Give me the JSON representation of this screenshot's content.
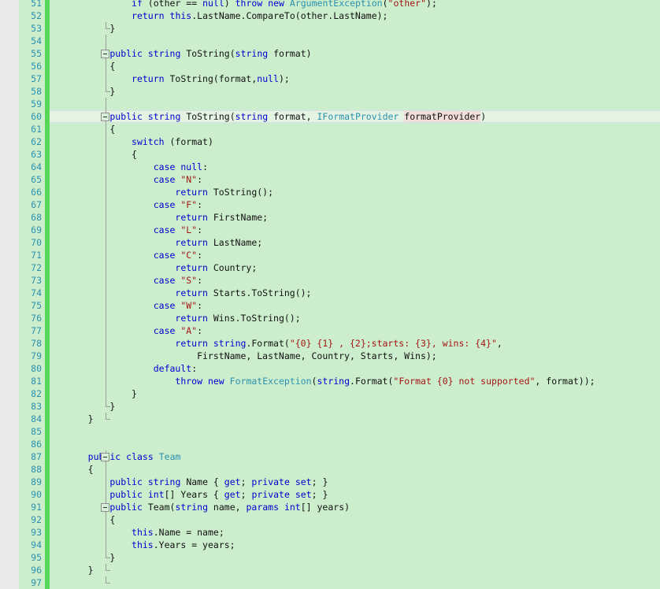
{
  "editor": {
    "language": "csharp",
    "first_visible_line": 51,
    "last_visible_line": 97,
    "current_line": 60,
    "line_height_px": 16,
    "colors": {
      "background": "#cdeecd",
      "current_line_background": "#e3f4e3",
      "gutter_background": "#cdeecd",
      "left_strip": "#e9e9ec",
      "change_bar": "#57d957",
      "line_number": "#2b91af",
      "keyword": "#0000d0",
      "type": "#2b91af",
      "string": "#a31515",
      "plain_text": "#101010",
      "fold_marker": "#8e8e8e",
      "highlighted_identifier": "#f1ded8"
    }
  },
  "lines": [
    {
      "number": 51,
      "indent": 12,
      "fold": null,
      "tokens": [
        {
          "t": "if",
          "c": "kw"
        },
        {
          "t": " (other == ",
          "c": "pln"
        },
        {
          "t": "null",
          "c": "kw"
        },
        {
          "t": ") ",
          "c": "pln"
        },
        {
          "t": "throw",
          "c": "kw"
        },
        {
          "t": " ",
          "c": "pln"
        },
        {
          "t": "new",
          "c": "kw"
        },
        {
          "t": " ",
          "c": "pln"
        },
        {
          "t": "ArgumentException",
          "c": "typ"
        },
        {
          "t": "(",
          "c": "pln"
        },
        {
          "t": "\"other\"",
          "c": "str"
        },
        {
          "t": ");",
          "c": "pln"
        }
      ]
    },
    {
      "number": 52,
      "indent": 12,
      "fold": null,
      "tokens": [
        {
          "t": "return",
          "c": "kw"
        },
        {
          "t": " ",
          "c": "pln"
        },
        {
          "t": "this",
          "c": "kw"
        },
        {
          "t": ".LastName.CompareTo(other.LastName);",
          "c": "pln"
        }
      ]
    },
    {
      "number": 53,
      "indent": 8,
      "fold": "end",
      "tokens": [
        {
          "t": "}",
          "c": "pln"
        }
      ]
    },
    {
      "number": 54,
      "indent": 0,
      "fold": "line",
      "tokens": []
    },
    {
      "number": 55,
      "indent": 8,
      "fold": "box",
      "tokens": [
        {
          "t": "public",
          "c": "kw"
        },
        {
          "t": " ",
          "c": "pln"
        },
        {
          "t": "string",
          "c": "kw"
        },
        {
          "t": " ToString(",
          "c": "pln"
        },
        {
          "t": "string",
          "c": "kw"
        },
        {
          "t": " format)",
          "c": "pln"
        }
      ]
    },
    {
      "number": 56,
      "indent": 8,
      "fold": "line",
      "tokens": [
        {
          "t": "{",
          "c": "pln"
        }
      ]
    },
    {
      "number": 57,
      "indent": 12,
      "fold": "line",
      "tokens": [
        {
          "t": "return",
          "c": "kw"
        },
        {
          "t": " ToString(format,",
          "c": "pln"
        },
        {
          "t": "null",
          "c": "kw"
        },
        {
          "t": ");",
          "c": "pln"
        }
      ]
    },
    {
      "number": 58,
      "indent": 8,
      "fold": "end",
      "tokens": [
        {
          "t": "}",
          "c": "pln"
        }
      ]
    },
    {
      "number": 59,
      "indent": 0,
      "fold": "line",
      "tokens": []
    },
    {
      "number": 60,
      "indent": 8,
      "fold": "box",
      "current": true,
      "tokens": [
        {
          "t": "public",
          "c": "kw"
        },
        {
          "t": " ",
          "c": "pln"
        },
        {
          "t": "string",
          "c": "kw"
        },
        {
          "t": " ToString(",
          "c": "pln"
        },
        {
          "t": "string",
          "c": "kw"
        },
        {
          "t": " format, ",
          "c": "pln"
        },
        {
          "t": "IFormatProvider",
          "c": "typ"
        },
        {
          "t": " ",
          "c": "pln"
        },
        {
          "t": "formatProvider",
          "c": "pln hl-ident"
        },
        {
          "t": ")",
          "c": "pln"
        }
      ]
    },
    {
      "number": 61,
      "indent": 8,
      "fold": "line",
      "tokens": [
        {
          "t": "{",
          "c": "pln"
        }
      ]
    },
    {
      "number": 62,
      "indent": 12,
      "fold": "line",
      "tokens": [
        {
          "t": "switch",
          "c": "kw"
        },
        {
          "t": " (format)",
          "c": "pln"
        }
      ]
    },
    {
      "number": 63,
      "indent": 12,
      "fold": "line",
      "tokens": [
        {
          "t": "{",
          "c": "pln"
        }
      ]
    },
    {
      "number": 64,
      "indent": 16,
      "fold": "line",
      "tokens": [
        {
          "t": "case",
          "c": "kw"
        },
        {
          "t": " ",
          "c": "pln"
        },
        {
          "t": "null",
          "c": "kw"
        },
        {
          "t": ":",
          "c": "pln"
        }
      ]
    },
    {
      "number": 65,
      "indent": 16,
      "fold": "line",
      "tokens": [
        {
          "t": "case",
          "c": "kw"
        },
        {
          "t": " ",
          "c": "pln"
        },
        {
          "t": "\"N\"",
          "c": "str"
        },
        {
          "t": ":",
          "c": "pln"
        }
      ]
    },
    {
      "number": 66,
      "indent": 20,
      "fold": "line",
      "tokens": [
        {
          "t": "return",
          "c": "kw"
        },
        {
          "t": " ToString();",
          "c": "pln"
        }
      ]
    },
    {
      "number": 67,
      "indent": 16,
      "fold": "line",
      "tokens": [
        {
          "t": "case",
          "c": "kw"
        },
        {
          "t": " ",
          "c": "pln"
        },
        {
          "t": "\"F\"",
          "c": "str"
        },
        {
          "t": ":",
          "c": "pln"
        }
      ]
    },
    {
      "number": 68,
      "indent": 20,
      "fold": "line",
      "tokens": [
        {
          "t": "return",
          "c": "kw"
        },
        {
          "t": " FirstName;",
          "c": "pln"
        }
      ]
    },
    {
      "number": 69,
      "indent": 16,
      "fold": "line",
      "tokens": [
        {
          "t": "case",
          "c": "kw"
        },
        {
          "t": " ",
          "c": "pln"
        },
        {
          "t": "\"L\"",
          "c": "str"
        },
        {
          "t": ":",
          "c": "pln"
        }
      ]
    },
    {
      "number": 70,
      "indent": 20,
      "fold": "line",
      "tokens": [
        {
          "t": "return",
          "c": "kw"
        },
        {
          "t": " LastName;",
          "c": "pln"
        }
      ]
    },
    {
      "number": 71,
      "indent": 16,
      "fold": "line",
      "tokens": [
        {
          "t": "case",
          "c": "kw"
        },
        {
          "t": " ",
          "c": "pln"
        },
        {
          "t": "\"C\"",
          "c": "str"
        },
        {
          "t": ":",
          "c": "pln"
        }
      ]
    },
    {
      "number": 72,
      "indent": 20,
      "fold": "line",
      "tokens": [
        {
          "t": "return",
          "c": "kw"
        },
        {
          "t": " Country;",
          "c": "pln"
        }
      ]
    },
    {
      "number": 73,
      "indent": 16,
      "fold": "line",
      "tokens": [
        {
          "t": "case",
          "c": "kw"
        },
        {
          "t": " ",
          "c": "pln"
        },
        {
          "t": "\"S\"",
          "c": "str"
        },
        {
          "t": ":",
          "c": "pln"
        }
      ]
    },
    {
      "number": 74,
      "indent": 20,
      "fold": "line",
      "tokens": [
        {
          "t": "return",
          "c": "kw"
        },
        {
          "t": " Starts.ToString();",
          "c": "pln"
        }
      ]
    },
    {
      "number": 75,
      "indent": 16,
      "fold": "line",
      "tokens": [
        {
          "t": "case",
          "c": "kw"
        },
        {
          "t": " ",
          "c": "pln"
        },
        {
          "t": "\"W\"",
          "c": "str"
        },
        {
          "t": ":",
          "c": "pln"
        }
      ]
    },
    {
      "number": 76,
      "indent": 20,
      "fold": "line",
      "tokens": [
        {
          "t": "return",
          "c": "kw"
        },
        {
          "t": " Wins.ToString();",
          "c": "pln"
        }
      ]
    },
    {
      "number": 77,
      "indent": 16,
      "fold": "line",
      "tokens": [
        {
          "t": "case",
          "c": "kw"
        },
        {
          "t": " ",
          "c": "pln"
        },
        {
          "t": "\"A\"",
          "c": "str"
        },
        {
          "t": ":",
          "c": "pln"
        }
      ]
    },
    {
      "number": 78,
      "indent": 20,
      "fold": "line",
      "tokens": [
        {
          "t": "return",
          "c": "kw"
        },
        {
          "t": " ",
          "c": "pln"
        },
        {
          "t": "string",
          "c": "kw"
        },
        {
          "t": ".Format(",
          "c": "pln"
        },
        {
          "t": "\"{0} {1} , {2};starts: {3}, wins: {4}\"",
          "c": "str"
        },
        {
          "t": ",",
          "c": "pln"
        }
      ]
    },
    {
      "number": 79,
      "indent": 24,
      "fold": "line",
      "tokens": [
        {
          "t": "FirstName, LastName, Country, Starts, Wins);",
          "c": "pln"
        }
      ]
    },
    {
      "number": 80,
      "indent": 16,
      "fold": "line",
      "tokens": [
        {
          "t": "default",
          "c": "kw"
        },
        {
          "t": ":",
          "c": "pln"
        }
      ]
    },
    {
      "number": 81,
      "indent": 20,
      "fold": "line",
      "tokens": [
        {
          "t": "throw",
          "c": "kw"
        },
        {
          "t": " ",
          "c": "pln"
        },
        {
          "t": "new",
          "c": "kw"
        },
        {
          "t": " ",
          "c": "pln"
        },
        {
          "t": "FormatException",
          "c": "typ"
        },
        {
          "t": "(",
          "c": "pln"
        },
        {
          "t": "string",
          "c": "kw"
        },
        {
          "t": ".Format(",
          "c": "pln"
        },
        {
          "t": "\"Format {0} not supported\"",
          "c": "str"
        },
        {
          "t": ", format));",
          "c": "pln"
        }
      ]
    },
    {
      "number": 82,
      "indent": 12,
      "fold": "line",
      "tokens": [
        {
          "t": "}",
          "c": "pln"
        }
      ]
    },
    {
      "number": 83,
      "indent": 8,
      "fold": "end",
      "tokens": [
        {
          "t": "}",
          "c": "pln"
        }
      ]
    },
    {
      "number": 84,
      "indent": 4,
      "fold": "end",
      "tokens": [
        {
          "t": "}",
          "c": "pln"
        }
      ]
    },
    {
      "number": 85,
      "indent": 0,
      "fold": null,
      "tokens": []
    },
    {
      "number": 86,
      "indent": 0,
      "fold": null,
      "tokens": []
    },
    {
      "number": 87,
      "indent": 4,
      "fold": "box",
      "tokens": [
        {
          "t": "public",
          "c": "kw"
        },
        {
          "t": " ",
          "c": "pln"
        },
        {
          "t": "class",
          "c": "kw"
        },
        {
          "t": " ",
          "c": "pln"
        },
        {
          "t": "Team",
          "c": "typ"
        }
      ]
    },
    {
      "number": 88,
      "indent": 4,
      "fold": "line",
      "tokens": [
        {
          "t": "{",
          "c": "pln"
        }
      ]
    },
    {
      "number": 89,
      "indent": 8,
      "fold": "line",
      "tokens": [
        {
          "t": "public",
          "c": "kw"
        },
        {
          "t": " ",
          "c": "pln"
        },
        {
          "t": "string",
          "c": "kw"
        },
        {
          "t": " Name { ",
          "c": "pln"
        },
        {
          "t": "get",
          "c": "kw"
        },
        {
          "t": "; ",
          "c": "pln"
        },
        {
          "t": "private",
          "c": "kw"
        },
        {
          "t": " ",
          "c": "pln"
        },
        {
          "t": "set",
          "c": "kw"
        },
        {
          "t": "; }",
          "c": "pln"
        }
      ]
    },
    {
      "number": 90,
      "indent": 8,
      "fold": "line",
      "tokens": [
        {
          "t": "public",
          "c": "kw"
        },
        {
          "t": " ",
          "c": "pln"
        },
        {
          "t": "int",
          "c": "kw"
        },
        {
          "t": "[] Years { ",
          "c": "pln"
        },
        {
          "t": "get",
          "c": "kw"
        },
        {
          "t": "; ",
          "c": "pln"
        },
        {
          "t": "private",
          "c": "kw"
        },
        {
          "t": " ",
          "c": "pln"
        },
        {
          "t": "set",
          "c": "kw"
        },
        {
          "t": "; }",
          "c": "pln"
        }
      ]
    },
    {
      "number": 91,
      "indent": 8,
      "fold": "box",
      "tokens": [
        {
          "t": "public",
          "c": "kw"
        },
        {
          "t": " Team(",
          "c": "pln"
        },
        {
          "t": "string",
          "c": "kw"
        },
        {
          "t": " name, ",
          "c": "pln"
        },
        {
          "t": "params",
          "c": "kw"
        },
        {
          "t": " ",
          "c": "pln"
        },
        {
          "t": "int",
          "c": "kw"
        },
        {
          "t": "[] years)",
          "c": "pln"
        }
      ]
    },
    {
      "number": 92,
      "indent": 8,
      "fold": "line",
      "tokens": [
        {
          "t": "{",
          "c": "pln"
        }
      ]
    },
    {
      "number": 93,
      "indent": 12,
      "fold": "line",
      "tokens": [
        {
          "t": "this",
          "c": "kw"
        },
        {
          "t": ".Name = name;",
          "c": "pln"
        }
      ]
    },
    {
      "number": 94,
      "indent": 12,
      "fold": "line",
      "tokens": [
        {
          "t": "this",
          "c": "kw"
        },
        {
          "t": ".Years = years;",
          "c": "pln"
        }
      ]
    },
    {
      "number": 95,
      "indent": 8,
      "fold": "end",
      "tokens": [
        {
          "t": "}",
          "c": "pln"
        }
      ]
    },
    {
      "number": 96,
      "indent": 4,
      "fold": "end",
      "tokens": [
        {
          "t": "}",
          "c": "pln"
        }
      ]
    },
    {
      "number": 97,
      "indent": 0,
      "fold": "end",
      "tokens": []
    }
  ]
}
